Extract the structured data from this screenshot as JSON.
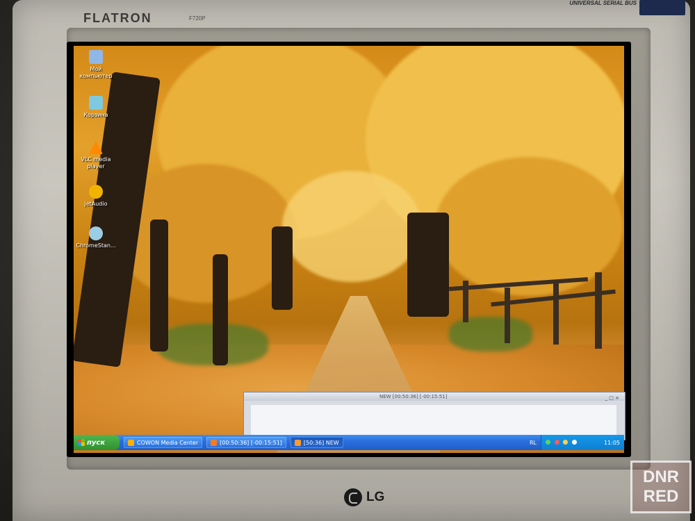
{
  "monitor": {
    "brand": "FLATRON",
    "model": "F720P",
    "usb_badge": "UNIVERSAL SERIAL BUS",
    "maker_logo": "LG"
  },
  "watermark": {
    "line1": "DNR",
    "line2": "RED"
  },
  "desktop": {
    "icons": [
      {
        "label": "Мой компьютер",
        "icon": "computer-icon",
        "color": "#8fb7e8"
      },
      {
        "label": "Корзина",
        "icon": "recycle-bin-icon",
        "color": "#7ec9e0"
      },
      {
        "label": "VLC media player",
        "icon": "vlc-cone-icon",
        "color": "#ff8a00"
      },
      {
        "label": "jetAudio",
        "icon": "jetaudio-icon",
        "color": "#f2b300"
      },
      {
        "label": "ChromeStan...",
        "icon": "chrome-icon",
        "color": "#9ccde6"
      }
    ]
  },
  "media_window": {
    "title": "NEW [00:50:36] [-00:15:51]",
    "controls": "_ □ ×"
  },
  "taskbar": {
    "start_label": "пуск",
    "tasks": [
      {
        "label": "COWON Media Center",
        "active": false
      },
      {
        "label": "[00:50:36] [-00:15:51]",
        "active": false
      },
      {
        "label": "[50:36] NEW",
        "active": true
      }
    ],
    "language": "RL",
    "clock": "11:05"
  },
  "colors": {
    "taskbar": "#2a6ddc",
    "start_button": "#3a9f3a",
    "tray": "#0f7fd3"
  }
}
